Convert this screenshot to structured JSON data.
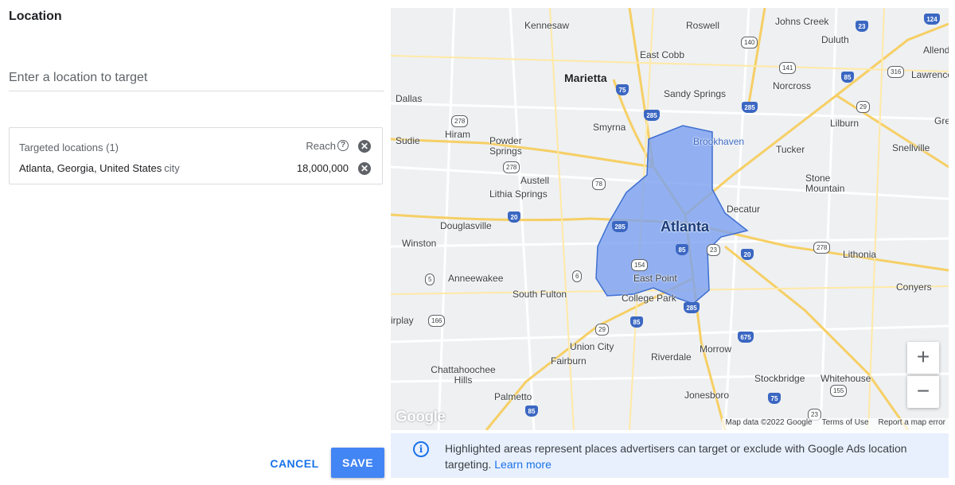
{
  "panel": {
    "title": "Location",
    "search_placeholder": "Enter a location to target"
  },
  "targets": {
    "header": "Targeted locations (1)",
    "reach_label": "Reach",
    "rows": [
      {
        "name": "Atlanta, Georgia, United States",
        "type": "city",
        "reach": "18,000,000"
      }
    ]
  },
  "actions": {
    "cancel": "CANCEL",
    "save": "SAVE"
  },
  "map": {
    "labels": {
      "kennesaw": "Kennesaw",
      "roswell": "Roswell",
      "johns_creek": "Johns Creek",
      "duluth": "Duluth",
      "allenda": "Allenda",
      "east_cobb": "East Cobb",
      "marietta": "Marietta",
      "norcross": "Norcross",
      "lawrencev": "Lawrencev",
      "dallas": "Dallas",
      "sandy_springs": "Sandy Springs",
      "lilburn": "Lilburn",
      "gre": "Gre",
      "smyrna": "Smyrna",
      "sudie": "Sudie",
      "hiram": "Hiram",
      "powder_springs": "Powder Springs",
      "brookhaven": "Brookhaven",
      "tucker": "Tucker",
      "snellville": "Snellville",
      "austell": "Austell",
      "stone_mountain": "Stone Mountain",
      "lithia_springs": "Lithia Springs",
      "decatur": "Decatur",
      "douglasville": "Douglasville",
      "atlanta": "Atlanta",
      "winston": "Winston",
      "lithonia": "Lithonia",
      "anneewakee": "Anneewakee",
      "east_point": "East Point",
      "conyers": "Conyers",
      "south_fulton": "South Fulton",
      "college_park": "College Park",
      "irplay": "irplay",
      "union_city": "Union City",
      "morrow": "Morrow",
      "fairburn": "Fairburn",
      "riverdale": "Riverdale",
      "chattahoochee_hills": "Chattahoochee Hills",
      "stockbridge": "Stockbridge",
      "whitehouse": "Whitehouse",
      "palmetto": "Palmetto",
      "jonesboro": "Jonesboro"
    },
    "shields": {
      "i75": "75",
      "i285": "285",
      "i85": "85",
      "i20": "20",
      "i675": "675",
      "i575": "575",
      "s140": "140",
      "s141": "141",
      "s316": "316",
      "s29": "29",
      "s278": "278",
      "s78": "78",
      "s154": "154",
      "s6": "6",
      "s5": "5",
      "s166": "166",
      "s23": "23",
      "s155": "155",
      "s124": "124"
    },
    "zoom_in": "+",
    "zoom_out": "−",
    "logo": "Google",
    "attribution": {
      "data": "Map data ©2022 Google",
      "terms": "Terms of Use",
      "report": "Report a map error"
    }
  },
  "info": {
    "text": "Highlighted areas represent places advertisers can target or exclude with Google Ads location targeting.",
    "link": "Learn more"
  },
  "colors": {
    "accent": "#1a73e8",
    "save_bg": "#4285f4",
    "highlight": "#7aa0f0",
    "info_bg": "#e8f0fe"
  }
}
